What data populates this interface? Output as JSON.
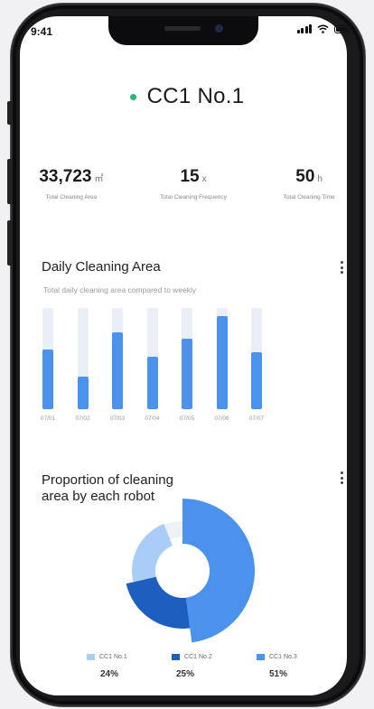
{
  "status_bar": {
    "time": "9:41"
  },
  "header": {
    "title": "CC1 No.1",
    "status_color": "#2bb673"
  },
  "stats": [
    {
      "value": "33,723",
      "unit": "㎡",
      "label": "Total Cleaning Area"
    },
    {
      "value": "15",
      "unit": "x",
      "label": "Total Cleaning Frequency"
    },
    {
      "value": "50",
      "unit": "h",
      "label": "Total Cleaning Time"
    }
  ],
  "daily_card": {
    "title": "Daily Cleaning Area",
    "subtitle": "Total daily cleaning area compared to weekly"
  },
  "proportion_card": {
    "title_line1": "Proportion of cleaning",
    "title_line2": "area by each robot"
  },
  "legend": [
    {
      "label": "CC1 No.1",
      "percent": "24%",
      "color": "#a9cdf7"
    },
    {
      "label": "CC1 No.2",
      "percent": "25%",
      "color": "#1c5fbf"
    },
    {
      "label": "CC1 No.3",
      "percent": "51%",
      "color": "#4a92ec"
    }
  ],
  "chart_data": [
    {
      "type": "bar",
      "title": "Daily Cleaning Area",
      "subtitle": "Total daily cleaning area compared to weekly",
      "categories": [
        "07/01",
        "07/02",
        "07/03",
        "07/04",
        "07/05",
        "07/06",
        "07/07"
      ],
      "values": [
        0.59,
        0.32,
        0.76,
        0.52,
        0.7,
        0.92,
        0.56
      ],
      "value_unit": "fraction of weekly",
      "ylim": [
        0,
        1
      ],
      "colors": {
        "fill": "#4a92ec",
        "track": "#e9eef7"
      }
    },
    {
      "type": "pie",
      "title": "Proportion of cleaning area by each robot",
      "categories": [
        "CC1 No.1",
        "CC1 No.2",
        "CC1 No.3"
      ],
      "values": [
        24,
        25,
        51
      ],
      "colors": [
        "#a9cdf7",
        "#1c5fbf",
        "#4a92ec"
      ],
      "remainder_color": "#eef2f7"
    }
  ]
}
